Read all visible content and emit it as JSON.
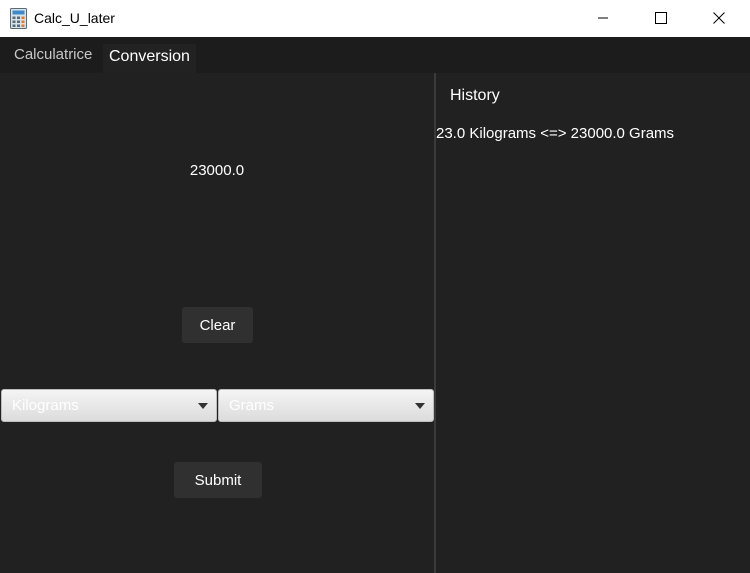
{
  "window": {
    "title": "Calc_U_later",
    "icon": "calculator-icon",
    "controls": [
      "minimize-icon",
      "maximize-icon",
      "close-icon"
    ]
  },
  "tabs": [
    {
      "label": "Calculatrice",
      "selected": false
    },
    {
      "label": "Conversion",
      "selected": true
    }
  ],
  "conversion": {
    "result": "23000.0",
    "clear_label": "Clear",
    "from_unit": "Kilograms",
    "to_unit": "Grams",
    "submit_label": "Submit"
  },
  "history": {
    "title": "History",
    "items": [
      "23.0 Kilograms <=> 23000.0 Grams"
    ]
  },
  "colors": {
    "background": "#212121",
    "tabbar": "#1c1c1c",
    "button": "#303030",
    "text": "#ffffff"
  }
}
